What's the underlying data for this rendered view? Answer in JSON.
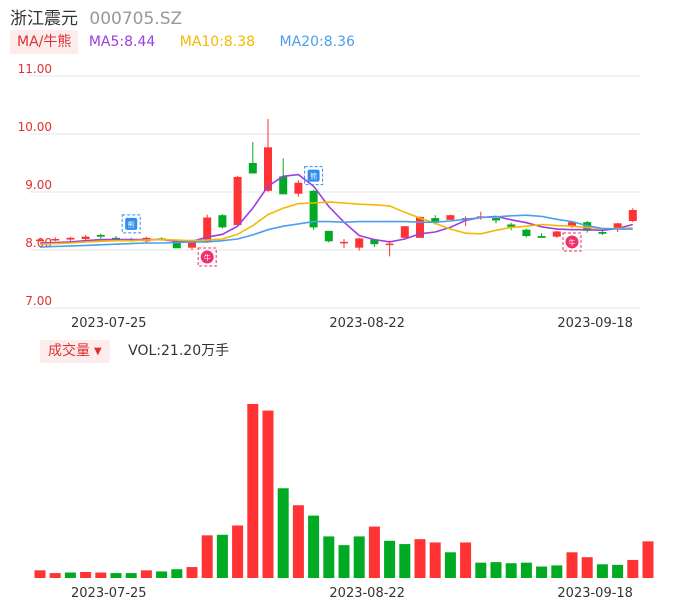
{
  "header": {
    "stock_name": "浙江震元",
    "stock_code": "000705.SZ"
  },
  "ma_legend": {
    "button_label": "MA/牛熊",
    "items": [
      {
        "label": "MA5:8.44",
        "color": "#9c3fe0"
      },
      {
        "label": "MA10:8.38",
        "color": "#f5b800"
      },
      {
        "label": "MA20:8.36",
        "color": "#4a9ff0"
      }
    ]
  },
  "volume_legend": {
    "button_label": "成交量",
    "value_label": "VOL:21.20万手"
  },
  "colors": {
    "up": "#ff3333",
    "down": "#00aa22",
    "grid": "#e6e6e6",
    "price_axis_text": "#e03131"
  },
  "chart_data": [
    {
      "type": "candlestick",
      "title": "",
      "y_ticks": [
        "11.00",
        "10.00",
        "9.00",
        "8.00",
        "7.00"
      ],
      "ylim": [
        7.0,
        11.0
      ],
      "x_tick_labels": [
        {
          "index": 4,
          "label": "2023-07-25"
        },
        {
          "index": 21,
          "label": "2023-08-22"
        },
        {
          "index": 36,
          "label": "2023-09-18"
        }
      ],
      "markers": [
        {
          "index": 6,
          "kind": "bear",
          "label": "熊"
        },
        {
          "index": 11,
          "kind": "bull",
          "label": "牛"
        },
        {
          "index": 18,
          "kind": "bear",
          "label": "熊"
        },
        {
          "index": 35,
          "kind": "bull",
          "label": "牛"
        }
      ],
      "ohlc": [
        [
          8.17,
          8.21,
          8.14,
          8.18
        ],
        [
          8.18,
          8.22,
          8.15,
          8.19
        ],
        [
          8.18,
          8.23,
          8.15,
          8.21
        ],
        [
          8.19,
          8.26,
          8.17,
          8.23
        ],
        [
          8.26,
          8.28,
          8.2,
          8.23
        ],
        [
          8.21,
          8.24,
          8.18,
          8.19
        ],
        [
          8.18,
          8.21,
          8.14,
          8.15
        ],
        [
          8.15,
          8.23,
          8.13,
          8.21
        ],
        [
          8.2,
          8.22,
          8.16,
          8.19
        ],
        [
          8.15,
          8.18,
          8.04,
          8.03
        ],
        [
          8.04,
          8.18,
          8.0,
          8.14
        ],
        [
          8.14,
          8.61,
          8.12,
          8.56
        ],
        [
          8.6,
          8.62,
          8.37,
          8.39
        ],
        [
          8.43,
          9.28,
          8.43,
          9.26
        ],
        [
          9.5,
          9.86,
          9.32,
          9.32
        ],
        [
          9.02,
          10.26,
          9.0,
          9.77
        ],
        [
          9.27,
          9.58,
          9.02,
          8.96
        ],
        [
          8.97,
          9.2,
          8.92,
          9.16
        ],
        [
          9.02,
          9.04,
          8.35,
          8.39
        ],
        [
          8.33,
          8.33,
          8.13,
          8.15
        ],
        [
          8.13,
          8.19,
          8.03,
          8.14
        ],
        [
          8.04,
          8.21,
          7.99,
          8.2
        ],
        [
          8.18,
          8.19,
          8.05,
          8.1
        ],
        [
          8.09,
          8.16,
          7.89,
          8.11
        ],
        [
          8.21,
          8.41,
          8.2,
          8.41
        ],
        [
          8.21,
          8.58,
          8.21,
          8.57
        ],
        [
          8.55,
          8.6,
          8.44,
          8.48
        ],
        [
          8.52,
          8.61,
          8.52,
          8.6
        ],
        [
          8.52,
          8.58,
          8.41,
          8.55
        ],
        [
          8.56,
          8.66,
          8.52,
          8.58
        ],
        [
          8.55,
          8.56,
          8.46,
          8.51
        ],
        [
          8.44,
          8.47,
          8.34,
          8.4
        ],
        [
          8.35,
          8.37,
          8.22,
          8.24
        ],
        [
          8.24,
          8.29,
          8.21,
          8.21
        ],
        [
          8.23,
          8.33,
          8.21,
          8.32
        ],
        [
          8.41,
          8.5,
          8.38,
          8.48
        ],
        [
          8.48,
          8.5,
          8.3,
          8.33
        ],
        [
          8.31,
          8.36,
          8.26,
          8.28
        ],
        [
          8.38,
          8.47,
          8.31,
          8.46
        ],
        [
          8.5,
          8.72,
          8.48,
          8.69
        ]
      ],
      "series": [
        {
          "name": "MA5",
          "values": [
            8.12,
            8.13,
            8.14,
            8.16,
            8.18,
            8.18,
            8.18,
            8.18,
            8.18,
            8.15,
            8.15,
            8.22,
            8.27,
            8.41,
            8.72,
            9.1,
            9.27,
            9.3,
            9.1,
            8.75,
            8.48,
            8.25,
            8.18,
            8.14,
            8.19,
            8.28,
            8.31,
            8.39,
            8.51,
            8.56,
            8.58,
            8.52,
            8.47,
            8.4,
            8.36,
            8.35,
            8.35,
            8.34,
            8.37,
            8.44
          ]
        },
        {
          "name": "MA10",
          "values": [
            8.1,
            8.11,
            8.12,
            8.14,
            8.15,
            8.16,
            8.16,
            8.17,
            8.18,
            8.17,
            8.16,
            8.17,
            8.19,
            8.27,
            8.42,
            8.61,
            8.72,
            8.8,
            8.81,
            8.83,
            8.81,
            8.79,
            8.78,
            8.76,
            8.65,
            8.55,
            8.46,
            8.36,
            8.29,
            8.28,
            8.34,
            8.39,
            8.41,
            8.44,
            8.42,
            8.41,
            8.39,
            8.37,
            8.37,
            8.38
          ]
        },
        {
          "name": "MA20",
          "values": [
            8.05,
            8.06,
            8.07,
            8.08,
            8.09,
            8.1,
            8.11,
            8.12,
            8.12,
            8.13,
            8.14,
            8.14,
            8.16,
            8.19,
            8.26,
            8.35,
            8.41,
            8.45,
            8.49,
            8.49,
            8.48,
            8.49,
            8.49,
            8.49,
            8.49,
            8.48,
            8.48,
            8.5,
            8.53,
            8.56,
            8.57,
            8.59,
            8.6,
            8.58,
            8.53,
            8.49,
            8.42,
            8.37,
            8.36,
            8.36
          ]
        }
      ]
    },
    {
      "type": "bar",
      "title": "",
      "value_unit": "万手",
      "x_tick_labels": [
        {
          "index": 4,
          "label": "2023-07-25"
        },
        {
          "index": 21,
          "label": "2023-08-22"
        },
        {
          "index": 36,
          "label": "2023-09-18"
        }
      ],
      "values": [
        1.4,
        0.9,
        1.0,
        1.1,
        1.0,
        0.9,
        0.9,
        1.4,
        1.2,
        1.6,
        2.0,
        7.8,
        7.9,
        9.6,
        31.8,
        30.6,
        16.4,
        13.3,
        11.4,
        7.6,
        6.0,
        7.6,
        9.4,
        6.8,
        6.2,
        7.1,
        6.5,
        4.7,
        6.5,
        2.8,
        2.9,
        2.7,
        2.8,
        2.1,
        2.3,
        4.7,
        3.8,
        2.5,
        2.4,
        3.3,
        6.7
      ],
      "direction": [
        "up",
        "up",
        "down",
        "up",
        "up",
        "down",
        "down",
        "up",
        "down",
        "down",
        "up",
        "up",
        "down",
        "up",
        "up",
        "up",
        "down",
        "up",
        "down",
        "down",
        "down",
        "down",
        "up",
        "down",
        "down",
        "up",
        "up",
        "down",
        "up",
        "down",
        "down",
        "down",
        "down",
        "down",
        "down",
        "up",
        "up",
        "down",
        "down",
        "up",
        "up"
      ]
    }
  ]
}
